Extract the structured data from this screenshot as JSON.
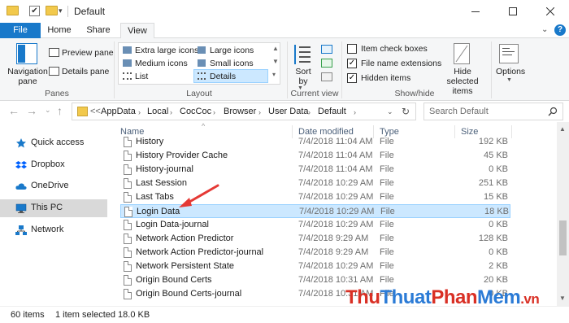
{
  "window": {
    "title": "Default"
  },
  "ribbon_tabs": [
    "File",
    "Home",
    "Share",
    "View"
  ],
  "panes_group": {
    "label": "Panes",
    "navigation_pane": "Navigation pane",
    "preview_pane": "Preview pane",
    "details_pane": "Details pane"
  },
  "layout_group": {
    "label": "Layout",
    "options": [
      "Extra large icons",
      "Large icons",
      "Medium icons",
      "Small icons",
      "List",
      "Details"
    ],
    "selected": "Details"
  },
  "current_view_group": {
    "label": "Current view",
    "sort_by": "Sort by"
  },
  "show_hide_group": {
    "label": "Show/hide",
    "item_check_boxes": {
      "label": "Item check boxes",
      "checked": false
    },
    "file_name_extensions": {
      "label": "File name extensions",
      "checked": true
    },
    "hidden_items": {
      "label": "Hidden items",
      "checked": true
    },
    "hide_selected": "Hide selected items"
  },
  "options_button": "Options",
  "address": {
    "prefix": "<<",
    "crumbs": [
      "AppData",
      "Local",
      "CocCoc",
      "Browser",
      "User Data",
      "Default"
    ]
  },
  "search": {
    "placeholder": "Search Default"
  },
  "nav_pane": [
    {
      "label": "Quick access",
      "icon": "star-icon"
    },
    {
      "label": "Dropbox",
      "icon": "dropbox-icon"
    },
    {
      "label": "OneDrive",
      "icon": "cloud-icon"
    },
    {
      "label": "This PC",
      "icon": "computer-icon"
    },
    {
      "label": "Network",
      "icon": "network-icon"
    }
  ],
  "columns": {
    "name": "Name",
    "date": "Date modified",
    "type": "Type",
    "size": "Size"
  },
  "files": [
    {
      "name": "History",
      "date": "7/4/2018 11:04 AM",
      "type": "File",
      "size": "192 KB"
    },
    {
      "name": "History Provider Cache",
      "date": "7/4/2018 11:04 AM",
      "type": "File",
      "size": "45 KB"
    },
    {
      "name": "History-journal",
      "date": "7/4/2018 11:04 AM",
      "type": "File",
      "size": "0 KB"
    },
    {
      "name": "Last Session",
      "date": "7/4/2018 10:29 AM",
      "type": "File",
      "size": "251 KB"
    },
    {
      "name": "Last Tabs",
      "date": "7/4/2018 10:29 AM",
      "type": "File",
      "size": "15 KB"
    },
    {
      "name": "Login Data",
      "date": "7/4/2018 10:29 AM",
      "type": "File",
      "size": "18 KB"
    },
    {
      "name": "Login Data-journal",
      "date": "7/4/2018 10:29 AM",
      "type": "File",
      "size": "0 KB"
    },
    {
      "name": "Network Action Predictor",
      "date": "7/4/2018 9:29 AM",
      "type": "File",
      "size": "128 KB"
    },
    {
      "name": "Network Action Predictor-journal",
      "date": "7/4/2018 9:29 AM",
      "type": "File",
      "size": "0 KB"
    },
    {
      "name": "Network Persistent State",
      "date": "7/4/2018 10:29 AM",
      "type": "File",
      "size": "2 KB"
    },
    {
      "name": "Origin Bound Certs",
      "date": "7/4/2018 10:31 AM",
      "type": "File",
      "size": "20 KB"
    },
    {
      "name": "Origin Bound Certs-journal",
      "date": "7/4/2018 10:31 AM",
      "type": "File",
      "size": "0 KB"
    }
  ],
  "selected_file": "Login Data",
  "status": {
    "items": "60 items",
    "selected": "1 item selected  18.0 KB"
  },
  "watermark": {
    "part1": "Thu",
    "part2": "Thuat",
    "part3": "Phan",
    "part4": "Mem",
    "part5": ".vn"
  },
  "colors": {
    "accent": "#1979ca",
    "selection": "#cce8ff",
    "arrow": "#e53935"
  }
}
